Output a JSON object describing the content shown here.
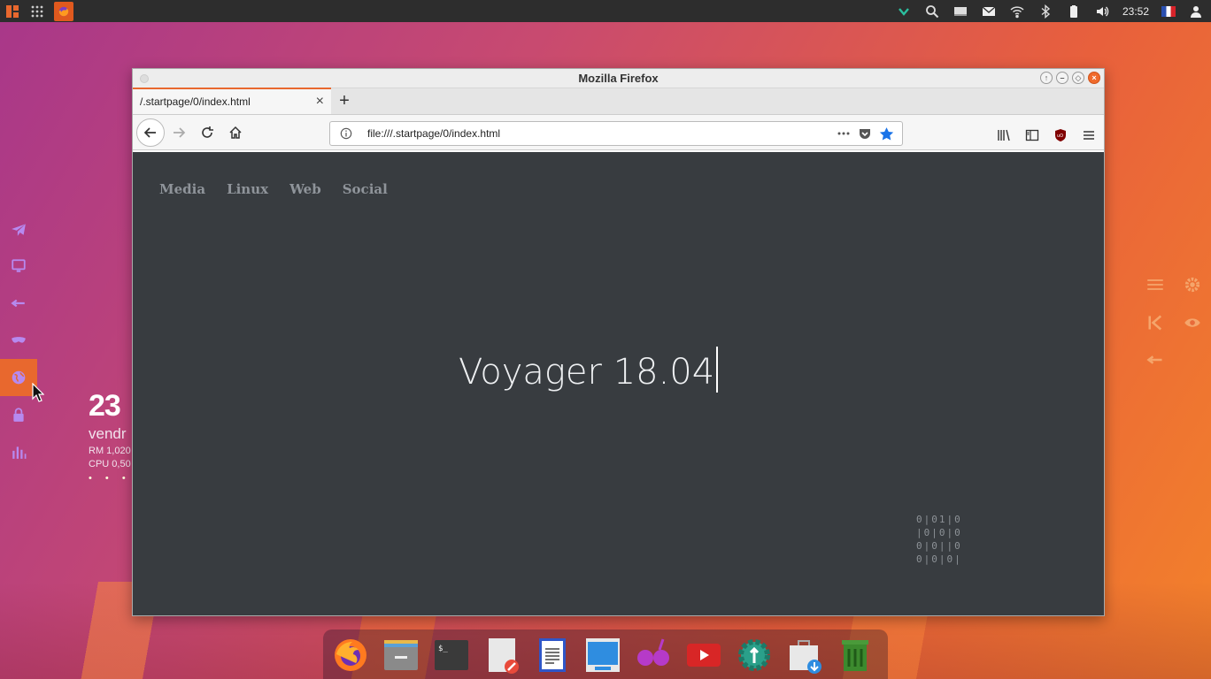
{
  "top_panel": {
    "clock": "23:52",
    "left_icons": [
      "app-menu-icon",
      "apps-grid-icon",
      "firefox-icon"
    ],
    "tray_icons": [
      "chevron-down-icon",
      "search-icon",
      "window-icon",
      "mail-icon",
      "wifi-icon",
      "bluetooth-icon",
      "battery-icon",
      "volume-icon"
    ]
  },
  "launcher": {
    "items": [
      "plane-icon",
      "monitor-icon",
      "arrow-left-icon",
      "mask-icon",
      "globe-icon",
      "lock-icon",
      "chart-icon"
    ],
    "active_index": 4
  },
  "conky": {
    "time": "23",
    "day": "vendr",
    "ram": "RM 1,020",
    "cpu": "CPU 0,50",
    "dots": "• • • •"
  },
  "window": {
    "title": "Mozilla Firefox",
    "tab": {
      "title": "/.startpage/0/index.html"
    },
    "url": "file:///.startpage/0/index.html"
  },
  "startpage": {
    "menu": [
      "Media",
      "Linux",
      "Web",
      "Social"
    ],
    "title": "Voyager 18.04",
    "binary": "0|01|0\n|0|0|0\n0|0||0\n0|0|0|"
  },
  "dock": {
    "apps": [
      "firefox",
      "files",
      "terminal",
      "text-editor",
      "writer",
      "screenshot",
      "media-player",
      "youtube",
      "settings",
      "software-store",
      "trash"
    ]
  },
  "colors": {
    "accent": "#e8682e",
    "content_bg": "#383c40",
    "menu_text": "#8f949a"
  }
}
